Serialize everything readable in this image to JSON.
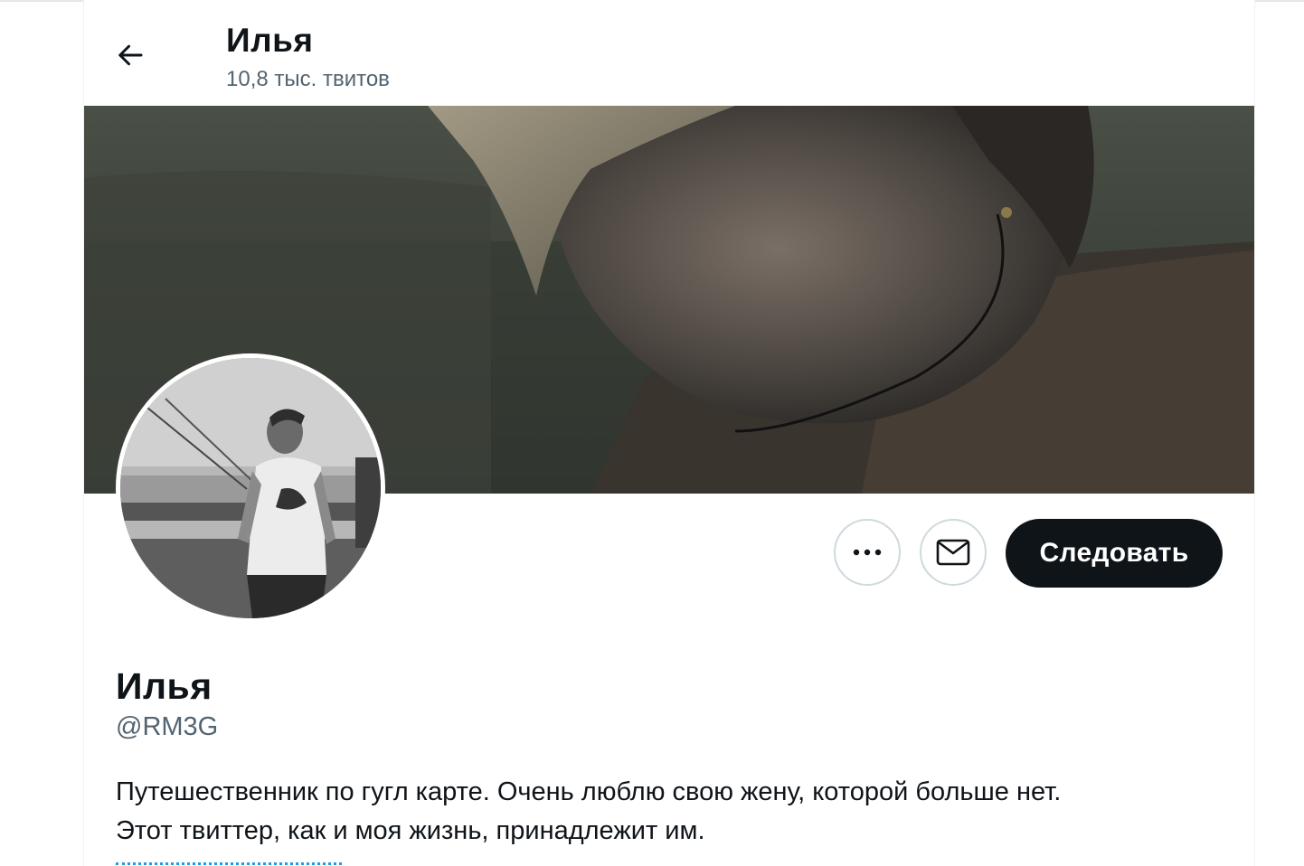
{
  "header": {
    "title": "Илья",
    "tweet_count": "10,8 тыс. твитов"
  },
  "profile": {
    "name": "Илья",
    "handle": "@RM3G",
    "bio_lines": [
      "Путешественник по гугл карте. Очень люблю свою жену, которой больше нет.",
      "Этот твиттер, как и моя жизнь, принадлежит им."
    ]
  },
  "actions": {
    "follow_label": "Следовать"
  },
  "icons": {
    "back": "arrow-left-icon",
    "more": "more-dots-icon",
    "message": "envelope-icon"
  },
  "colors": {
    "follow_bg": "#0f1419",
    "secondary_text": "#536471",
    "link": "#1d9bf0"
  }
}
